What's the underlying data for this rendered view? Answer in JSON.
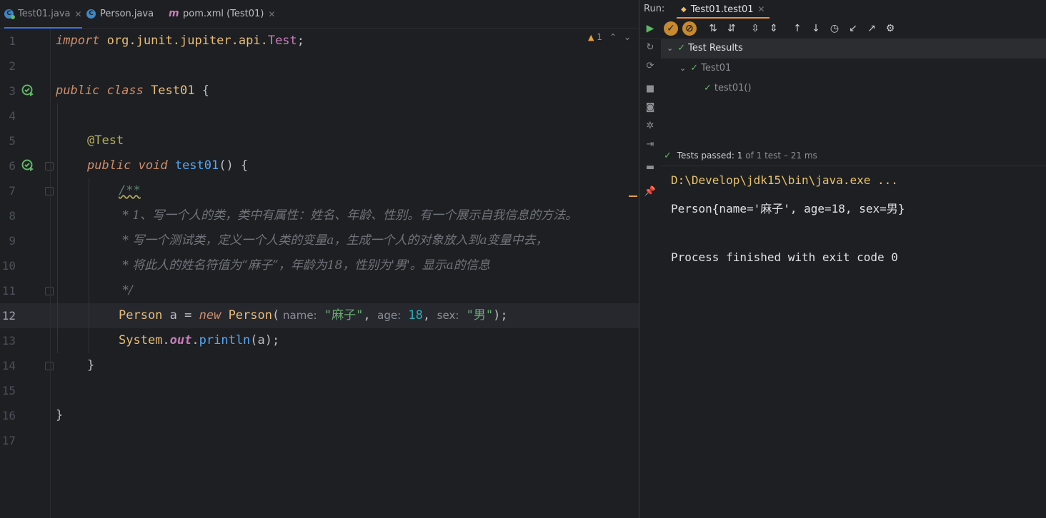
{
  "tabs": [
    {
      "label": "Test01.java",
      "icon": "class-test-icon",
      "active": true
    },
    {
      "label": "Person.java",
      "icon": "class-icon",
      "active": false
    },
    {
      "label": "pom.xml (Test01)",
      "icon": "maven-icon",
      "active": false
    }
  ],
  "editor": {
    "warning_count": "1",
    "line_numbers": [
      "1",
      "2",
      "3",
      "4",
      "5",
      "6",
      "7",
      "8",
      "9",
      "10",
      "11",
      "12",
      "13",
      "14",
      "15",
      "16",
      "17"
    ],
    "line1": {
      "kw": "import",
      "pkg": " org.junit.jupiter.api.",
      "cls": "Test",
      "end": ";"
    },
    "line3": {
      "kw": "public class",
      "name": " Test01",
      "brace": " {"
    },
    "line5": {
      "ann": "@Test"
    },
    "line6": {
      "kw": "public void",
      "fn": " test01",
      "rest": "() {"
    },
    "line7": {
      "doc": "/**"
    },
    "line8": {
      "cmt": " * 1、写一个人的类，类中有属性：姓名、年龄、性别。有一个展示自我信息的方法。"
    },
    "line9": {
      "cmt": " * 写一个测试类，定义一个人类的变量a，生成一个人的对象放入到a变量中去，"
    },
    "line10": {
      "cmt": " * 将此人的姓名符值为“麻子”，年龄为18，性别为'男'。显示a的信息"
    },
    "line11": {
      "cmt": " */"
    },
    "line12": {
      "cls1": "Person",
      "var": " a = ",
      "kw": "new",
      "cls2": " Person",
      "paren": "(",
      "hint_name": " name:",
      "str_name": "\"麻子\"",
      "comma1": ",",
      "hint_age": "  age:",
      "num_age": "18",
      "comma2": ",",
      "hint_sex": "  sex:",
      "str_sex": "\"男\"",
      "end": ");"
    },
    "line13": {
      "cls": "System",
      "dot1": ".",
      "fld": "out",
      "dot2": ".",
      "fn": "println",
      "rest": "(a);"
    },
    "line14": {
      "brace": "}"
    },
    "line16": {
      "brace": "}"
    }
  },
  "run_panel": {
    "label": "Run:",
    "tab_label": "Test01.test01",
    "tree": {
      "root": "Test Results",
      "class": "Test01",
      "method": "test01()"
    },
    "status": {
      "passed_label": "Tests passed:",
      "passed_count": "1",
      "rest": "of 1 test – 21 ms"
    },
    "console": [
      "D:\\Develop\\jdk15\\bin\\java.exe ...",
      "Person{name='麻子', age=18, sex=男}",
      "Process finished with exit code 0"
    ]
  },
  "colors": {
    "background": "#1e1f22",
    "keyword": "#cf8e6d",
    "string": "#6aab73",
    "number": "#2aacb8",
    "function": "#56a8f5",
    "pass": "#5fb865",
    "run_tab_accent": "#f08f3c"
  }
}
